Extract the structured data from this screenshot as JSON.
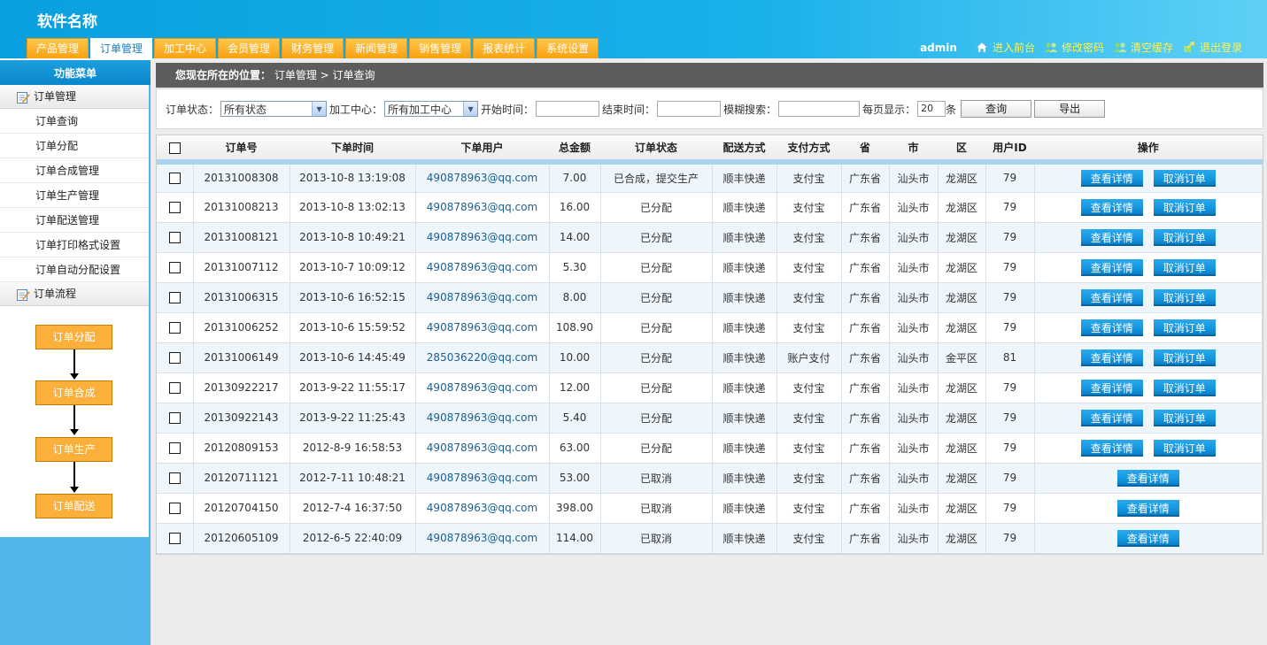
{
  "app": {
    "title": "软件名称"
  },
  "nav": {
    "tabs": [
      "产品管理",
      "订单管理",
      "加工中心",
      "会员管理",
      "财务管理",
      "新闻管理",
      "销售管理",
      "报表统计",
      "系统设置"
    ],
    "active_index": 1
  },
  "user_bar": {
    "username": "admin",
    "links": [
      {
        "label": "进入前台",
        "icon": "home-icon"
      },
      {
        "label": "修改密码",
        "icon": "users-icon"
      },
      {
        "label": "清空缓存",
        "icon": "users-icon"
      },
      {
        "label": "退出登录",
        "icon": "logout-icon"
      }
    ]
  },
  "sidebar": {
    "title": "功能菜单",
    "group1": "订单管理",
    "items": [
      "订单查询",
      "订单分配",
      "订单合成管理",
      "订单生产管理",
      "订单配送管理",
      "订单打印格式设置",
      "订单自动分配设置"
    ],
    "group2": "订单流程",
    "flow": [
      "订单分配",
      "订单合成",
      "订单生产",
      "订单配送"
    ]
  },
  "breadcrumb": {
    "prefix": "您现在所在的位置：",
    "path": "订单管理 > 订单查询"
  },
  "filter": {
    "status_label": "订单状态：",
    "status_value": "所有状态",
    "center_label": "加工中心：",
    "center_value": "所有加工中心",
    "start_label": "开始时间：",
    "start_value": "",
    "end_label": "结束时间：",
    "end_value": "",
    "fuzzy_label": "模糊搜索：",
    "fuzzy_value": "",
    "page_label": "每页显示：",
    "page_value": "20",
    "page_unit": "条",
    "query_button": "查询",
    "export_button": "导出"
  },
  "table": {
    "headers": [
      "订单号",
      "下单时间",
      "下单用户",
      "总金额",
      "订单状态",
      "配送方式",
      "支付方式",
      "省",
      "市",
      "区",
      "用户ID",
      "操作"
    ],
    "view_label": "查看详情",
    "cancel_label": "取消订单",
    "rows": [
      {
        "id": "20131008308",
        "time": "2013-10-8 13:19:08",
        "user": "490878963@qq.com",
        "amount": "7.00",
        "status": "已合成，提交生产",
        "ship": "顺丰快递",
        "pay": "支付宝",
        "prov": "广东省",
        "city": "汕头市",
        "dist": "龙湖区",
        "uid": "79",
        "cancel": true
      },
      {
        "id": "20131008213",
        "time": "2013-10-8 13:02:13",
        "user": "490878963@qq.com",
        "amount": "16.00",
        "status": "已分配",
        "ship": "顺丰快递",
        "pay": "支付宝",
        "prov": "广东省",
        "city": "汕头市",
        "dist": "龙湖区",
        "uid": "79",
        "cancel": true
      },
      {
        "id": "20131008121",
        "time": "2013-10-8 10:49:21",
        "user": "490878963@qq.com",
        "amount": "14.00",
        "status": "已分配",
        "ship": "顺丰快递",
        "pay": "支付宝",
        "prov": "广东省",
        "city": "汕头市",
        "dist": "龙湖区",
        "uid": "79",
        "cancel": true
      },
      {
        "id": "20131007112",
        "time": "2013-10-7 10:09:12",
        "user": "490878963@qq.com",
        "amount": "5.30",
        "status": "已分配",
        "ship": "顺丰快递",
        "pay": "支付宝",
        "prov": "广东省",
        "city": "汕头市",
        "dist": "龙湖区",
        "uid": "79",
        "cancel": true
      },
      {
        "id": "20131006315",
        "time": "2013-10-6 16:52:15",
        "user": "490878963@qq.com",
        "amount": "8.00",
        "status": "已分配",
        "ship": "顺丰快递",
        "pay": "支付宝",
        "prov": "广东省",
        "city": "汕头市",
        "dist": "龙湖区",
        "uid": "79",
        "cancel": true
      },
      {
        "id": "20131006252",
        "time": "2013-10-6 15:59:52",
        "user": "490878963@qq.com",
        "amount": "108.90",
        "status": "已分配",
        "ship": "顺丰快递",
        "pay": "支付宝",
        "prov": "广东省",
        "city": "汕头市",
        "dist": "龙湖区",
        "uid": "79",
        "cancel": true
      },
      {
        "id": "20131006149",
        "time": "2013-10-6 14:45:49",
        "user": "285036220@qq.com",
        "amount": "10.00",
        "status": "已分配",
        "ship": "顺丰快递",
        "pay": "账户支付",
        "prov": "广东省",
        "city": "汕头市",
        "dist": "金平区",
        "uid": "81",
        "cancel": true
      },
      {
        "id": "20130922217",
        "time": "2013-9-22 11:55:17",
        "user": "490878963@qq.com",
        "amount": "12.00",
        "status": "已分配",
        "ship": "顺丰快递",
        "pay": "支付宝",
        "prov": "广东省",
        "city": "汕头市",
        "dist": "龙湖区",
        "uid": "79",
        "cancel": true
      },
      {
        "id": "20130922143",
        "time": "2013-9-22 11:25:43",
        "user": "490878963@qq.com",
        "amount": "5.40",
        "status": "已分配",
        "ship": "顺丰快递",
        "pay": "支付宝",
        "prov": "广东省",
        "city": "汕头市",
        "dist": "龙湖区",
        "uid": "79",
        "cancel": true
      },
      {
        "id": "20120809153",
        "time": "2012-8-9 16:58:53",
        "user": "490878963@qq.com",
        "amount": "63.00",
        "status": "已分配",
        "ship": "顺丰快递",
        "pay": "支付宝",
        "prov": "广东省",
        "city": "汕头市",
        "dist": "龙湖区",
        "uid": "79",
        "cancel": true
      },
      {
        "id": "20120711121",
        "time": "2012-7-11 10:48:21",
        "user": "490878963@qq.com",
        "amount": "53.00",
        "status": "已取消",
        "ship": "顺丰快递",
        "pay": "支付宝",
        "prov": "广东省",
        "city": "汕头市",
        "dist": "龙湖区",
        "uid": "79",
        "cancel": false
      },
      {
        "id": "20120704150",
        "time": "2012-7-4 16:37:50",
        "user": "490878963@qq.com",
        "amount": "398.00",
        "status": "已取消",
        "ship": "顺丰快递",
        "pay": "支付宝",
        "prov": "广东省",
        "city": "汕头市",
        "dist": "龙湖区",
        "uid": "79",
        "cancel": false
      },
      {
        "id": "20120605109",
        "time": "2012-6-5 22:40:09",
        "user": "490878963@qq.com",
        "amount": "114.00",
        "status": "已取消",
        "ship": "顺丰快递",
        "pay": "支付宝",
        "prov": "广东省",
        "city": "汕头市",
        "dist": "龙湖区",
        "uid": "79",
        "cancel": false
      }
    ]
  },
  "colors": {
    "header_blue": "#0a9fdf",
    "tab_orange": "#f7a212",
    "link_yellow": "#fff34d",
    "button_blue": "#1596df",
    "flow_orange": "#fbb03b"
  }
}
